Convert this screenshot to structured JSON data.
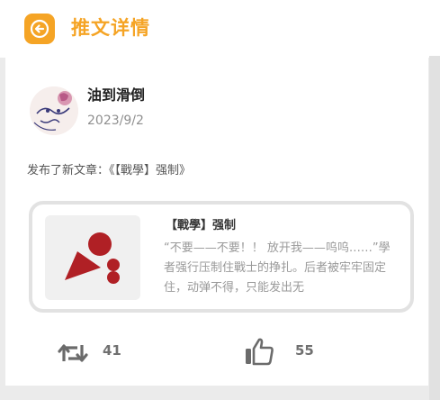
{
  "header": {
    "title": "推文详情",
    "back_icon": "arrow-left-icon",
    "accent_color": "#f5a425"
  },
  "post": {
    "author": "油到滑倒",
    "date": "2023/9/2",
    "text": "发布了新文章：《【戰學】强制》"
  },
  "article": {
    "title": "【戰學】强制",
    "excerpt": "“不要——不要！！ 放开我——呜呜……”學者强行压制住戰士的挣扎。后者被牢牢固定住，动弹不得，只能发出无",
    "thumbnail_icon": "article-placeholder-icon",
    "thumbnail_color": "#b02025"
  },
  "actions": {
    "retweet_icon": "retweet-icon",
    "retweet_count": "41",
    "like_icon": "thumbs-up-icon",
    "like_count": "55"
  }
}
